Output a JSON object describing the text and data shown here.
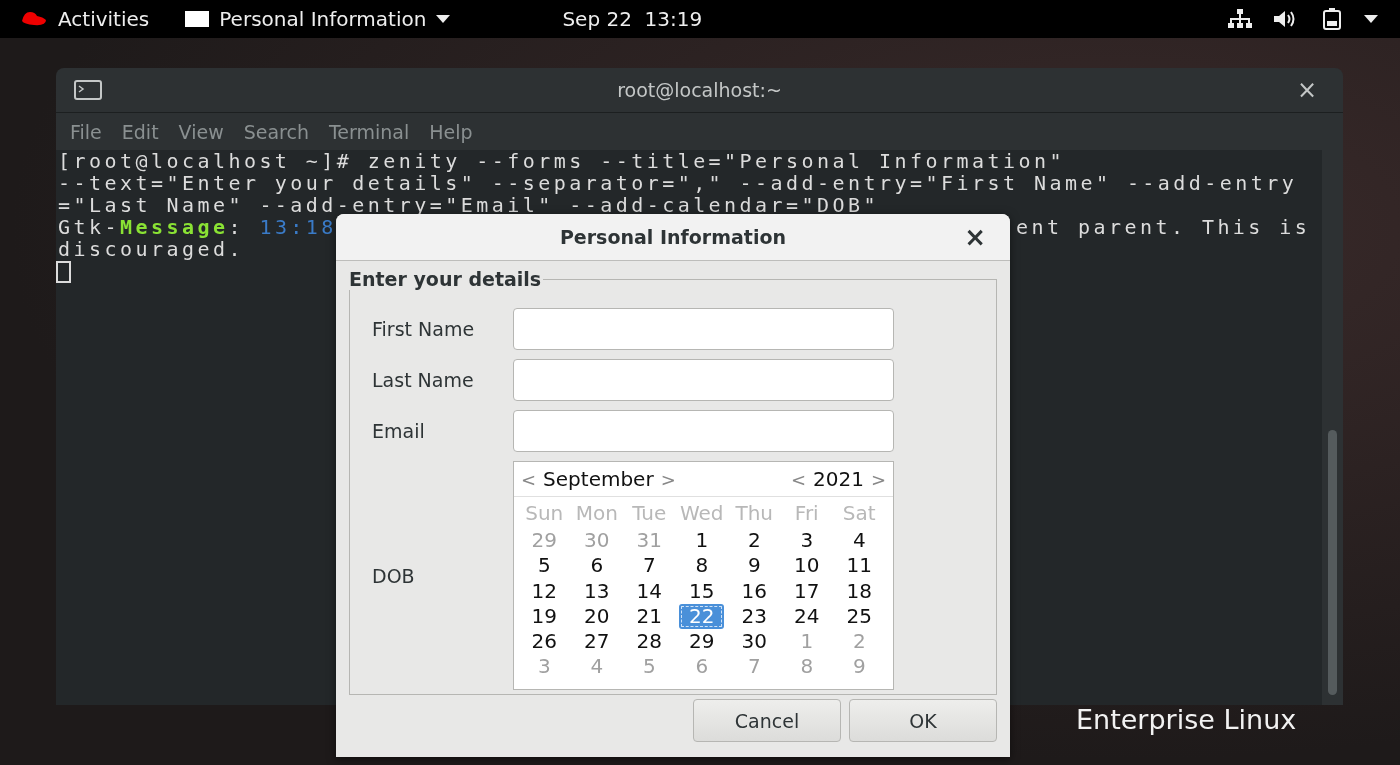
{
  "top_bar": {
    "activities": "Activities",
    "app_menu": "Personal Information",
    "clock": "Sep 22  13:19"
  },
  "desktop": {
    "brand_text": "Enterprise Linux"
  },
  "terminal": {
    "title": "root@localhost:~",
    "close": "×",
    "menu": [
      "File",
      "Edit",
      "View",
      "Search",
      "Terminal",
      "Help"
    ],
    "lines": [
      [
        {
          "kind": "plain",
          "text": "[root@localhost ~]# zenity --forms --title=\"Personal Information\""
        }
      ],
      [
        {
          "kind": "plain",
          "text": "--text=\"Enter your details\" --separator=\",\" --add-entry=\"First Name\" --add-entry"
        }
      ],
      [
        {
          "kind": "plain",
          "text": "=\"Last Name\" --add-entry=\"Email\" --add-calendar=\"DOB\""
        }
      ],
      [
        {
          "kind": "plain",
          "text": "Gtk-"
        },
        {
          "kind": "level",
          "text": "Message"
        },
        {
          "kind": "plain",
          "text": ": "
        },
        {
          "kind": "time",
          "text": "13:18"
        },
        {
          "kind": "tail",
          "text": "ent parent. This is"
        }
      ],
      [
        {
          "kind": "plain",
          "text": "discouraged."
        }
      ]
    ]
  },
  "dialog": {
    "title": "Personal Information",
    "close": "×",
    "frame_label": "Enter your details",
    "entries": [
      {
        "label": "First Name"
      },
      {
        "label": "Last Name"
      },
      {
        "label": "Email"
      }
    ],
    "calendar": {
      "label": "DOB",
      "month": "September",
      "year": "2021",
      "prev": "<",
      "next": ">",
      "weekdays": [
        "Sun",
        "Mon",
        "Tue",
        "Wed",
        "Thu",
        "Fri",
        "Sat"
      ],
      "days": [
        {
          "label": "29",
          "other_month": true,
          "selected": false
        },
        {
          "label": "30",
          "other_month": true,
          "selected": false
        },
        {
          "label": "31",
          "other_month": true,
          "selected": false
        },
        {
          "label": "1",
          "other_month": false,
          "selected": false
        },
        {
          "label": "2",
          "other_month": false,
          "selected": false
        },
        {
          "label": "3",
          "other_month": false,
          "selected": false
        },
        {
          "label": "4",
          "other_month": false,
          "selected": false
        },
        {
          "label": "5",
          "other_month": false,
          "selected": false
        },
        {
          "label": "6",
          "other_month": false,
          "selected": false
        },
        {
          "label": "7",
          "other_month": false,
          "selected": false
        },
        {
          "label": "8",
          "other_month": false,
          "selected": false
        },
        {
          "label": "9",
          "other_month": false,
          "selected": false
        },
        {
          "label": "10",
          "other_month": false,
          "selected": false
        },
        {
          "label": "11",
          "other_month": false,
          "selected": false
        },
        {
          "label": "12",
          "other_month": false,
          "selected": false
        },
        {
          "label": "13",
          "other_month": false,
          "selected": false
        },
        {
          "label": "14",
          "other_month": false,
          "selected": false
        },
        {
          "label": "15",
          "other_month": false,
          "selected": false
        },
        {
          "label": "16",
          "other_month": false,
          "selected": false
        },
        {
          "label": "17",
          "other_month": false,
          "selected": false
        },
        {
          "label": "18",
          "other_month": false,
          "selected": false
        },
        {
          "label": "19",
          "other_month": false,
          "selected": false
        },
        {
          "label": "20",
          "other_month": false,
          "selected": false
        },
        {
          "label": "21",
          "other_month": false,
          "selected": false
        },
        {
          "label": "22",
          "other_month": false,
          "selected": true
        },
        {
          "label": "23",
          "other_month": false,
          "selected": false
        },
        {
          "label": "24",
          "other_month": false,
          "selected": false
        },
        {
          "label": "25",
          "other_month": false,
          "selected": false
        },
        {
          "label": "26",
          "other_month": false,
          "selected": false
        },
        {
          "label": "27",
          "other_month": false,
          "selected": false
        },
        {
          "label": "28",
          "other_month": false,
          "selected": false
        },
        {
          "label": "29",
          "other_month": false,
          "selected": false
        },
        {
          "label": "30",
          "other_month": false,
          "selected": false
        },
        {
          "label": "1",
          "other_month": true,
          "selected": false
        },
        {
          "label": "2",
          "other_month": true,
          "selected": false
        },
        {
          "label": "3",
          "other_month": true,
          "selected": false
        },
        {
          "label": "4",
          "other_month": true,
          "selected": false
        },
        {
          "label": "5",
          "other_month": true,
          "selected": false
        },
        {
          "label": "6",
          "other_month": true,
          "selected": false
        },
        {
          "label": "7",
          "other_month": true,
          "selected": false
        },
        {
          "label": "8",
          "other_month": true,
          "selected": false
        },
        {
          "label": "9",
          "other_month": true,
          "selected": false
        }
      ]
    },
    "buttons": [
      "Cancel",
      "OK"
    ]
  }
}
